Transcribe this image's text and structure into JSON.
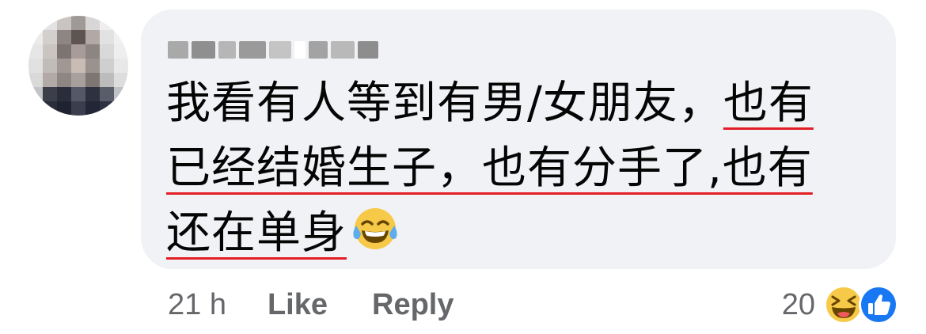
{
  "comment": {
    "author_name": "",
    "text_lines": [
      {
        "plain": "我看有人等到有男/女朋友，",
        "underlined": "也有"
      },
      {
        "underlined": "已经结婚生子，也有分手了,也有"
      },
      {
        "underlined": "还在单身"
      }
    ],
    "inline_emoji": "tears-of-joy-emoji",
    "timestamp": "21 h",
    "like_label": "Like",
    "reply_label": "Reply",
    "reaction_count": "20",
    "reaction_icons": [
      "haha-reaction-icon",
      "like-reaction-icon"
    ]
  },
  "colors": {
    "bubble_bg": "#f0f2f5",
    "text": "#050505",
    "meta_text": "#65676b",
    "underline": "#e41e26",
    "like_blue": "#1877f2",
    "emoji_yellow": "#f7c948"
  }
}
